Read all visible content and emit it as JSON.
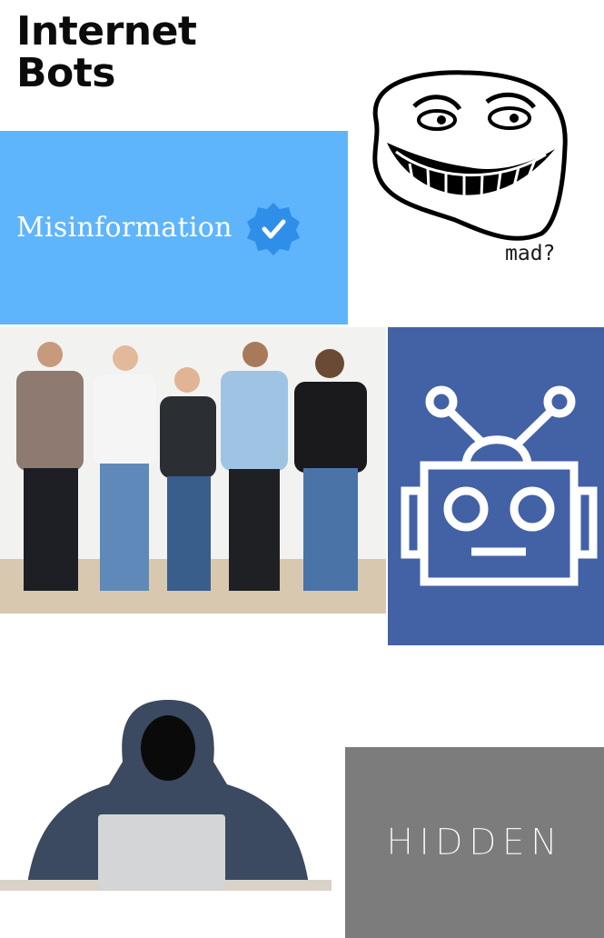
{
  "title": {
    "line1": "Internet",
    "line2": "Bots"
  },
  "misinformation_panel": {
    "label": "Misinformation",
    "badge_icon": "verified-check-icon",
    "color": "#5fb5fb"
  },
  "troll": {
    "caption": "mad?",
    "icon": "troll-face-icon"
  },
  "people_photo": {
    "icon": "people-on-phones-photo"
  },
  "robot_panel": {
    "icon": "robot-icon",
    "color": "#4361a5"
  },
  "hacker_photo": {
    "icon": "hooded-hacker-photo"
  },
  "hidden_panel": {
    "label": "HIDDEN",
    "color": "#7c7c7c"
  }
}
